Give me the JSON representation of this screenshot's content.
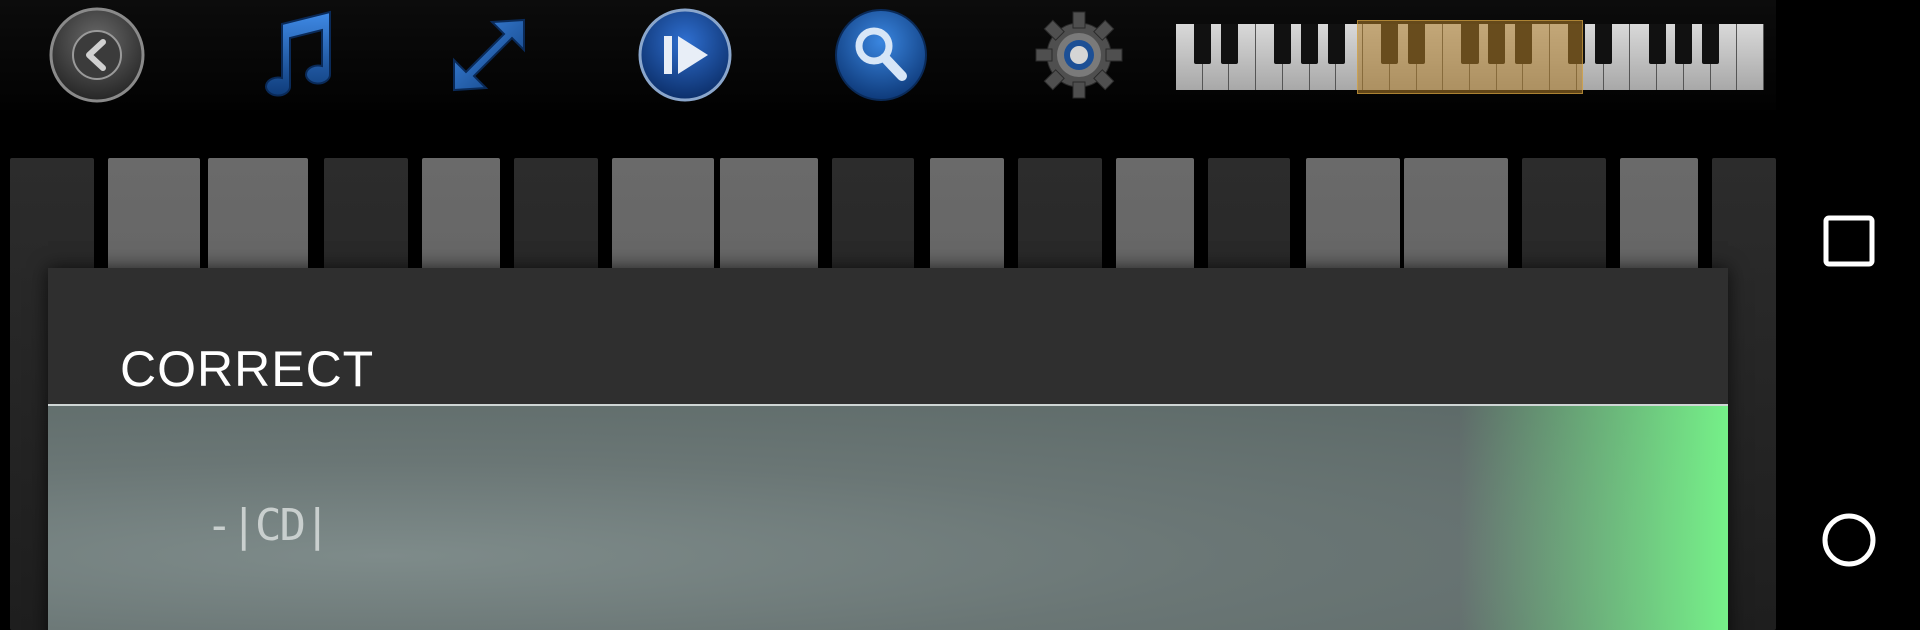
{
  "toolbar": {
    "buttons": [
      {
        "name": "back",
        "icon": "back-arrow-icon"
      },
      {
        "name": "music",
        "icon": "music-note-icon"
      },
      {
        "name": "resize",
        "icon": "expand-arrows-icon"
      },
      {
        "name": "play",
        "icon": "play-icon"
      },
      {
        "name": "search",
        "icon": "magnifier-icon"
      },
      {
        "name": "settings",
        "icon": "gear-icon"
      }
    ],
    "accent_blue": "#1d5fb0",
    "mini_keyboard_window_color": "#b07e28"
  },
  "dialog": {
    "title": "CORRECT",
    "answer_text": "-|CD|",
    "feedback_color": "#7cff8c"
  },
  "navbar": {
    "recents_icon": "square-icon",
    "home_icon": "circle-icon"
  }
}
